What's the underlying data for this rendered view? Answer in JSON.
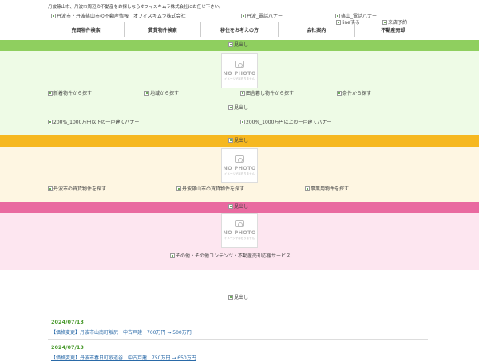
{
  "header": {
    "tagline": "丹波篠山市、丹波市周辺の不動産をお探しならオフィスキムラ株式会社にお任せ下さい。",
    "logo_alt": "丹波市・丹波篠山市の不動産情報　オフィスキムラ株式会社",
    "tamba_tel_alt": "丹波_電話バナー",
    "sasayama_tel_alt": "篠山_電話バナー",
    "line_alt": "lineする",
    "visit_alt": "来店予約"
  },
  "nav": {
    "items": [
      "売買物件検索",
      "賃貸物件検索",
      "移住をお考えの方",
      "会社案内",
      "不動産売却"
    ]
  },
  "colors": {
    "green": "#8fcf5f",
    "green_light": "#eefbe6",
    "yellow": "#f6b820",
    "yellow_light": "#fef6e2",
    "pink": "#e96aa0",
    "pink_light": "#fde6f0",
    "news_date": "#4a9a2e",
    "news_link": "#2a6aa8"
  },
  "nophoto": {
    "title": "NO PHOTO",
    "subtitle": "イメージが存在りません"
  },
  "section1": {
    "heading_alt": "見出し",
    "items": [
      "新着物件から探す",
      "地域から探す",
      "田舎暮し物件から探す",
      "条件から探す"
    ],
    "heading2_alt": "見出し",
    "banner_under": "200%_1000万円以下の一戸建てバナー",
    "banner_over": "200%_1000万円以上の一戸建てバナー"
  },
  "section2": {
    "heading_alt": "見出し",
    "items": [
      "丹波市の賃貸物件を探す",
      "丹波篠山市の賃貸物件を探す",
      "事業用物件を探す"
    ]
  },
  "section3": {
    "heading_alt": "見出し",
    "item": "その他・その他コンテンツ・不動産売却応援サービス"
  },
  "news": {
    "heading_alt": "見出し",
    "items": [
      {
        "date": "2024/07/13",
        "title": "【価格変更】丹波市山南町坂尻　中古戸建　700万円 → 500万円"
      },
      {
        "date": "2024/07/13",
        "title": "【価格変更】丹波市春日町歌道谷　中古戸建　750万円 → 650万円"
      }
    ]
  }
}
